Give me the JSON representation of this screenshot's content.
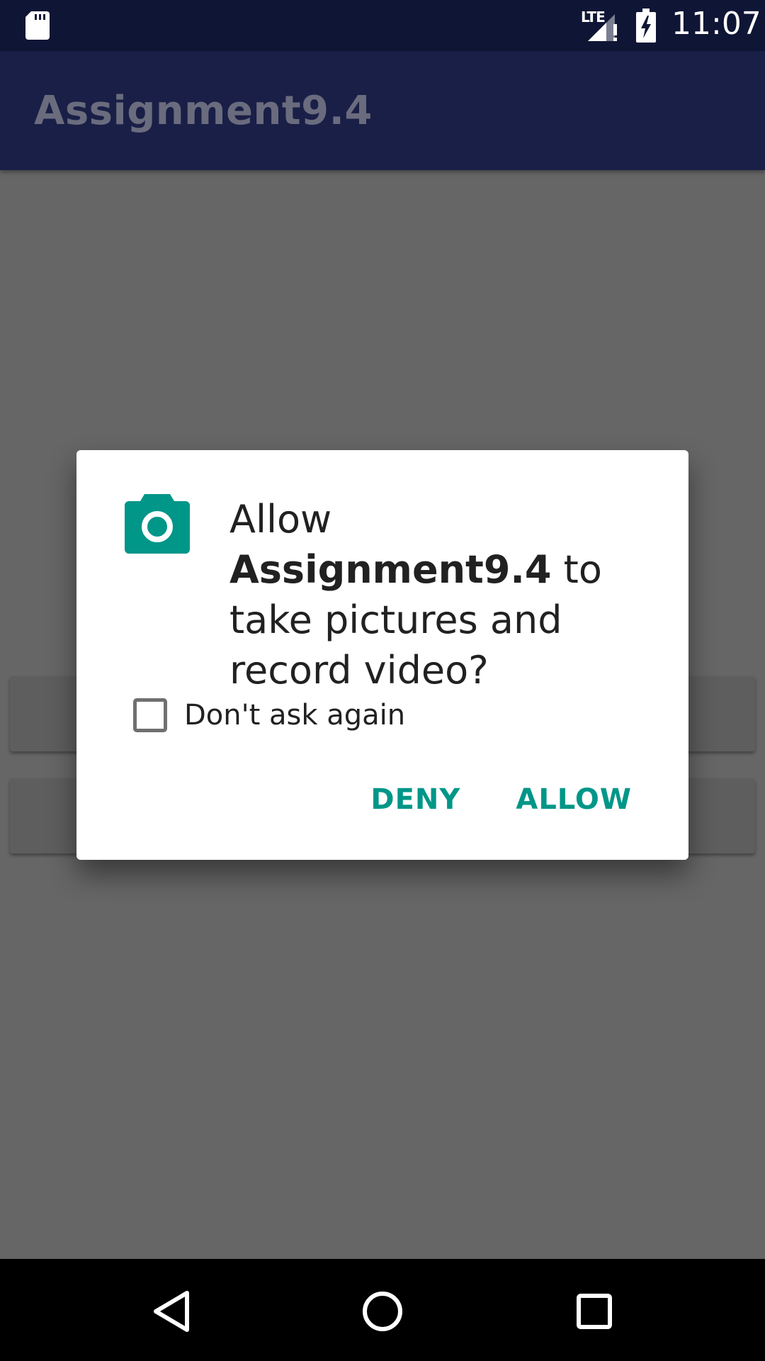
{
  "status_bar": {
    "time": "11:07",
    "network_label": "LTE",
    "icons": [
      "sd-card-icon",
      "lte-signal-icon",
      "battery-charging-icon"
    ]
  },
  "app_bar": {
    "title": "Assignment9.4"
  },
  "dialog": {
    "icon": "camera-icon",
    "message_prefix": "Allow ",
    "app_name": "Assignment9.4",
    "message_suffix": " to take pictures and record video?",
    "checkbox_label": "Don't ask again",
    "checkbox_checked": false,
    "deny_label": "DENY",
    "allow_label": "ALLOW",
    "accent_color": "#009688"
  },
  "nav_bar": {
    "icons": [
      "back-icon",
      "home-icon",
      "recents-icon"
    ]
  }
}
